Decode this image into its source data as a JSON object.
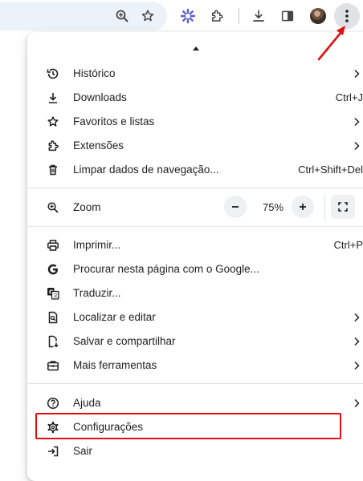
{
  "toolbar": {
    "icons": [
      "zoom-in-icon",
      "bookmark-star-icon",
      "extension-flower-icon",
      "extensions-puzzle-icon",
      "download-icon",
      "side-panel-icon",
      "avatar",
      "three-dot-menu-icon"
    ]
  },
  "menu": {
    "groups": [
      [
        {
          "id": "historico",
          "icon": "history-icon",
          "label": "Histórico",
          "shortcut": "",
          "submenu": true
        },
        {
          "id": "downloads",
          "icon": "download-icon",
          "label": "Downloads",
          "shortcut": "Ctrl+J",
          "submenu": false
        },
        {
          "id": "favoritos",
          "icon": "star-icon",
          "label": "Favoritos e listas",
          "shortcut": "",
          "submenu": true
        },
        {
          "id": "extensoes",
          "icon": "puzzle-icon",
          "label": "Extensões",
          "shortcut": "",
          "submenu": true
        },
        {
          "id": "limpar",
          "icon": "trash-icon",
          "label": "Limpar dados de navegação...",
          "shortcut": "Ctrl+Shift+Del",
          "submenu": false
        }
      ],
      [
        {
          "id": "imprimir",
          "icon": "printer-icon",
          "label": "Imprimir...",
          "shortcut": "Ctrl+P",
          "submenu": false
        },
        {
          "id": "procurar",
          "icon": "google-g-icon",
          "label": "Procurar nesta página com o Google...",
          "shortcut": "",
          "submenu": false
        },
        {
          "id": "traduzir",
          "icon": "translate-icon",
          "label": "Traduzir...",
          "shortcut": "",
          "submenu": false
        },
        {
          "id": "localizar",
          "icon": "find-page-icon",
          "label": "Localizar e editar",
          "shortcut": "",
          "submenu": true
        },
        {
          "id": "salvar",
          "icon": "save-share-icon",
          "label": "Salvar e compartilhar",
          "shortcut": "",
          "submenu": true
        },
        {
          "id": "mais",
          "icon": "toolbox-icon",
          "label": "Mais ferramentas",
          "shortcut": "",
          "submenu": true
        }
      ],
      [
        {
          "id": "ajuda",
          "icon": "help-icon",
          "label": "Ajuda",
          "shortcut": "",
          "submenu": true
        },
        {
          "id": "configuracoes",
          "icon": "settings-gear-icon",
          "label": "Configurações",
          "shortcut": "",
          "submenu": false
        },
        {
          "id": "sair",
          "icon": "exit-icon",
          "label": "Sair",
          "shortcut": "",
          "submenu": false
        }
      ]
    ],
    "zoom": {
      "label": "Zoom",
      "value": "75%",
      "minus": "−",
      "plus": "+"
    }
  },
  "annotation": {
    "highlight_item": "Configurações",
    "highlight_color": "#e01010"
  },
  "colors": {
    "accent_blue": "#0b57d0",
    "menu_text": "#1f1f1f",
    "omnibox_bg": "#edf2fa"
  }
}
